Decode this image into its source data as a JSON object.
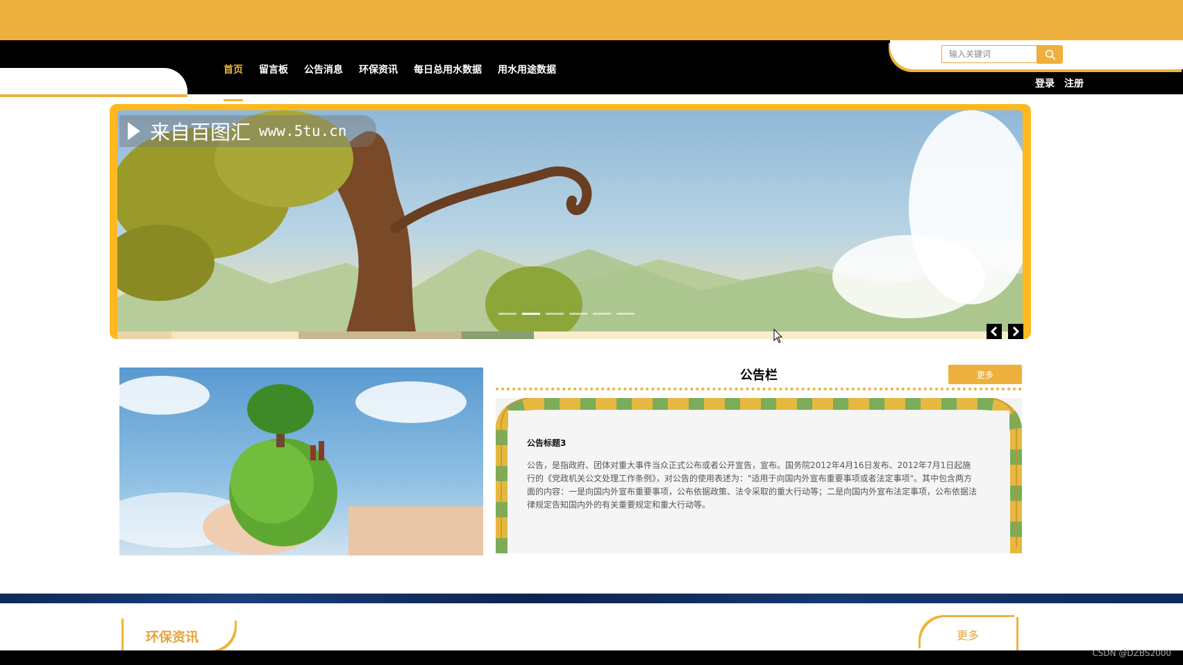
{
  "nav": {
    "items": [
      {
        "label": "首页",
        "active": true
      },
      {
        "label": "留言板"
      },
      {
        "label": "公告消息"
      },
      {
        "label": "环保资讯"
      },
      {
        "label": "每日总用水数据"
      },
      {
        "label": "用水用途数据"
      }
    ]
  },
  "search": {
    "placeholder": "输入关键词",
    "icon": "search-icon"
  },
  "auth": {
    "login": "登录",
    "register": "注册"
  },
  "banner": {
    "watermark_text": "来自百图汇",
    "watermark_site": "www.5tu.cn",
    "slide_count": 6,
    "active_slide": 1,
    "prev_icon": "chevron-left-icon",
    "next_icon": "chevron-right-icon"
  },
  "notice": {
    "section_title": "公告栏",
    "more_label": "更多",
    "post_title": "公告标题3",
    "post_body": "公告，是指政府、团体对重大事件当众正式公布或者公开宣告，宣布。国务院2012年4月16日发布、2012年7月1日起施行的《党政机关公文处理工作条例》，对公告的使用表述为：\"适用于向国内外宣布重要事项或者法定事项\"。其中包含两方面的内容：一是向国内外宣布重要事项，公布依据政策、法令采取的重大行动等；二是向国内外宣布法定事项，公布依据法律规定告知国内外的有关重要规定和重大行动等。"
  },
  "news": {
    "section_title": "环保资讯",
    "more_label": "更多"
  },
  "footer": {
    "credit": "CSDN @DZBS2000"
  },
  "colors": {
    "accent": "#eeb03c",
    "nav_bg": "#000000",
    "banner_frame": "#ffb820"
  }
}
